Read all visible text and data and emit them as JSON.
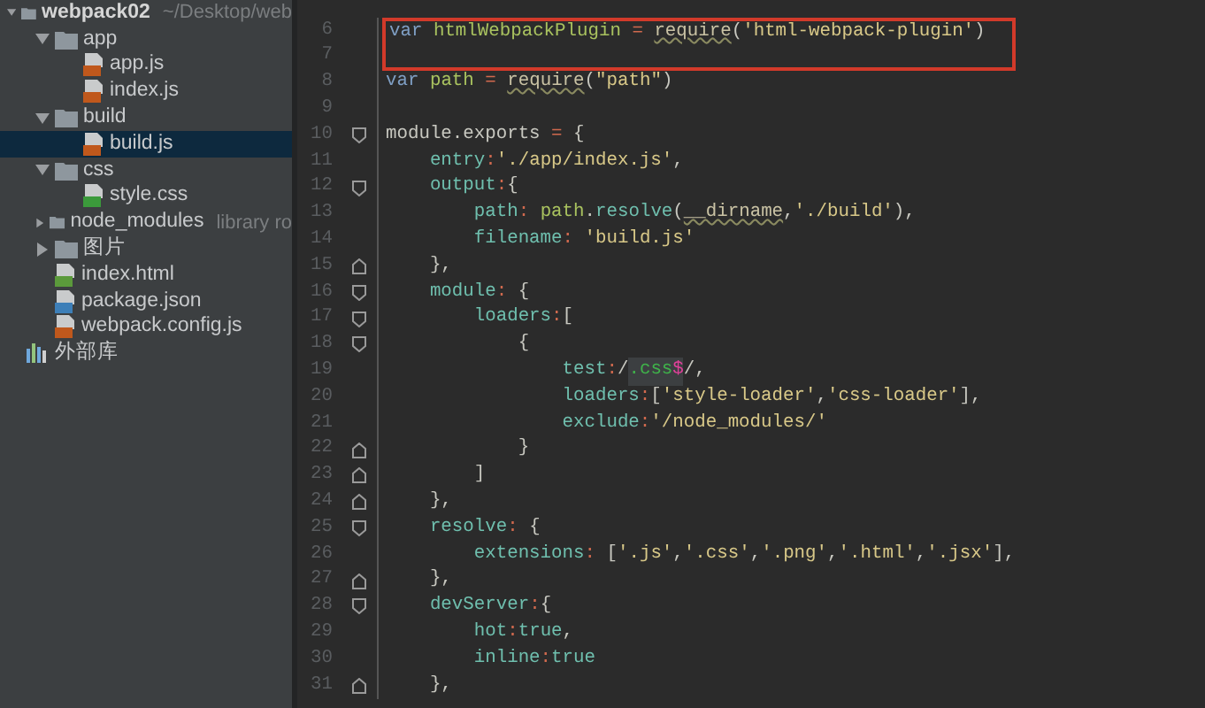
{
  "project_tree": [
    {
      "name": "webpack02",
      "note": "~/Desktop/web",
      "kind": "root",
      "expanded": true,
      "selected": false,
      "children": [
        {
          "name": "app",
          "kind": "folder",
          "expanded": true,
          "selected": false,
          "children": [
            {
              "name": "app.js",
              "kind": "js",
              "selected": false
            },
            {
              "name": "index.js",
              "kind": "js",
              "selected": false
            }
          ]
        },
        {
          "name": "build",
          "kind": "folder",
          "expanded": true,
          "selected": false,
          "children": [
            {
              "name": "build.js",
              "kind": "js",
              "selected": true
            }
          ]
        },
        {
          "name": "css",
          "kind": "folder",
          "expanded": true,
          "selected": false,
          "children": [
            {
              "name": "style.css",
              "kind": "css",
              "selected": false
            }
          ]
        },
        {
          "name": "node_modules",
          "note": "library ro",
          "kind": "folder",
          "expanded": false,
          "selected": false
        },
        {
          "name": "图片",
          "kind": "folder",
          "expanded": false,
          "selected": false
        },
        {
          "name": "index.html",
          "kind": "html",
          "selected": false
        },
        {
          "name": "package.json",
          "kind": "json",
          "selected": false
        },
        {
          "name": "webpack.config.js",
          "kind": "js",
          "selected": false
        }
      ]
    },
    {
      "name": "外部库",
      "kind": "library",
      "selected": false
    }
  ],
  "editor": {
    "lines": [
      {
        "number": "6",
        "kind": "plain",
        "highlighted": true,
        "tokens": [
          {
            "kind": "keyword",
            "text": "var "
          },
          {
            "kind": "variable",
            "text": "htmlWebpackPlugin "
          },
          {
            "kind": "operator",
            "text": "= "
          },
          {
            "kind": "call",
            "text": "require"
          },
          {
            "kind": "plain",
            "text": "("
          },
          {
            "kind": "string",
            "text": "'html-webpack-plugin'"
          },
          {
            "kind": "plain",
            "text": ")"
          }
        ]
      },
      {
        "number": "7",
        "kind": "plain",
        "highlighted": true
      },
      {
        "number": "8",
        "kind": "plain",
        "highlighted": false,
        "tokens": [
          {
            "kind": "keyword",
            "text": "var "
          },
          {
            "kind": "variable",
            "text": "path "
          },
          {
            "kind": "operator",
            "text": "= "
          },
          {
            "kind": "call",
            "text": "require"
          },
          {
            "kind": "plain",
            "text": "("
          },
          {
            "kind": "string",
            "text": "\"path\""
          },
          {
            "kind": "plain",
            "text": ")"
          }
        ]
      },
      {
        "number": "9",
        "kind": "plain",
        "highlighted": false
      },
      {
        "number": "10",
        "kind": "fold_open",
        "highlighted": false,
        "tokens": [
          {
            "kind": "plain",
            "text": "module.exports "
          },
          {
            "kind": "operator",
            "text": "= "
          },
          {
            "kind": "plain",
            "text": "{"
          }
        ]
      },
      {
        "number": "11",
        "kind": "plain",
        "highlighted": false,
        "tokens": [
          {
            "kind": "property",
            "text": "    entry"
          },
          {
            "kind": "operator",
            "text": ":"
          },
          {
            "kind": "string",
            "text": "'./app/index.js'"
          },
          {
            "kind": "plain",
            "text": ","
          }
        ]
      },
      {
        "number": "12",
        "kind": "fold_open",
        "highlighted": false,
        "tokens": [
          {
            "kind": "property",
            "text": "    output"
          },
          {
            "kind": "operator",
            "text": ":"
          },
          {
            "kind": "plain",
            "text": "{"
          }
        ]
      },
      {
        "number": "13",
        "kind": "plain",
        "highlighted": false,
        "tokens": [
          {
            "kind": "property",
            "text": "        path"
          },
          {
            "kind": "operator",
            "text": ": "
          },
          {
            "kind": "variable",
            "text": "path"
          },
          {
            "kind": "plain",
            "text": "."
          },
          {
            "kind": "property",
            "text": "resolve"
          },
          {
            "kind": "plain",
            "text": "("
          },
          {
            "kind": "call",
            "text": "__dirname"
          },
          {
            "kind": "plain",
            "text": ","
          },
          {
            "kind": "string",
            "text": "'./build'"
          },
          {
            "kind": "plain",
            "text": "),"
          }
        ]
      },
      {
        "number": "14",
        "kind": "plain",
        "highlighted": false,
        "tokens": [
          {
            "kind": "property",
            "text": "        filename"
          },
          {
            "kind": "operator",
            "text": ": "
          },
          {
            "kind": "string",
            "text": "'build.js'"
          }
        ]
      },
      {
        "number": "15",
        "kind": "fold_close",
        "highlighted": false,
        "tokens": [
          {
            "kind": "plain",
            "text": "    },"
          }
        ]
      },
      {
        "number": "16",
        "kind": "fold_open",
        "highlighted": false,
        "tokens": [
          {
            "kind": "property",
            "text": "    module"
          },
          {
            "kind": "operator",
            "text": ": "
          },
          {
            "kind": "plain",
            "text": "{"
          }
        ]
      },
      {
        "number": "17",
        "kind": "fold_open",
        "highlighted": false,
        "tokens": [
          {
            "kind": "property",
            "text": "        loaders"
          },
          {
            "kind": "operator",
            "text": ":"
          },
          {
            "kind": "plain",
            "text": "["
          }
        ]
      },
      {
        "number": "18",
        "kind": "fold_open",
        "highlighted": false,
        "tokens": [
          {
            "kind": "plain",
            "text": "            {"
          }
        ]
      },
      {
        "number": "19",
        "kind": "plain",
        "highlighted": false,
        "tokens": [
          {
            "kind": "property",
            "text": "                test"
          },
          {
            "kind": "operator",
            "text": ":"
          },
          {
            "kind": "plain",
            "text": "/"
          },
          {
            "kind": "regex",
            "text": ".css"
          },
          {
            "kind": "regex_anchor",
            "text": "$"
          },
          {
            "kind": "plain",
            "text": "/,"
          }
        ]
      },
      {
        "number": "20",
        "kind": "plain",
        "highlighted": false,
        "tokens": [
          {
            "kind": "property",
            "text": "                loaders"
          },
          {
            "kind": "operator",
            "text": ":"
          },
          {
            "kind": "plain",
            "text": "["
          },
          {
            "kind": "string",
            "text": "'style-loader'"
          },
          {
            "kind": "plain",
            "text": ","
          },
          {
            "kind": "string",
            "text": "'css-loader'"
          },
          {
            "kind": "plain",
            "text": "],"
          }
        ]
      },
      {
        "number": "21",
        "kind": "plain",
        "highlighted": false,
        "tokens": [
          {
            "kind": "property",
            "text": "                exclude"
          },
          {
            "kind": "operator",
            "text": ":"
          },
          {
            "kind": "string",
            "text": "'/node_modules/'"
          }
        ]
      },
      {
        "number": "22",
        "kind": "fold_close",
        "highlighted": false,
        "tokens": [
          {
            "kind": "plain",
            "text": "            }"
          }
        ]
      },
      {
        "number": "23",
        "kind": "fold_close",
        "highlighted": false,
        "tokens": [
          {
            "kind": "plain",
            "text": "        ]"
          }
        ]
      },
      {
        "number": "24",
        "kind": "fold_close",
        "highlighted": false,
        "tokens": [
          {
            "kind": "plain",
            "text": "    },"
          }
        ]
      },
      {
        "number": "25",
        "kind": "fold_open",
        "highlighted": false,
        "tokens": [
          {
            "kind": "property",
            "text": "    resolve"
          },
          {
            "kind": "operator",
            "text": ": "
          },
          {
            "kind": "plain",
            "text": "{"
          }
        ]
      },
      {
        "number": "26",
        "kind": "plain",
        "highlighted": false,
        "tokens": [
          {
            "kind": "property",
            "text": "        extensions"
          },
          {
            "kind": "operator",
            "text": ": "
          },
          {
            "kind": "plain",
            "text": "["
          },
          {
            "kind": "string",
            "text": "'.js'"
          },
          {
            "kind": "plain",
            "text": ","
          },
          {
            "kind": "string",
            "text": "'.css'"
          },
          {
            "kind": "plain",
            "text": ","
          },
          {
            "kind": "string",
            "text": "'.png'"
          },
          {
            "kind": "plain",
            "text": ","
          },
          {
            "kind": "string",
            "text": "'.html'"
          },
          {
            "kind": "plain",
            "text": ","
          },
          {
            "kind": "string",
            "text": "'.jsx'"
          },
          {
            "kind": "plain",
            "text": "],"
          }
        ]
      },
      {
        "number": "27",
        "kind": "fold_close",
        "highlighted": false,
        "tokens": [
          {
            "kind": "plain",
            "text": "    },"
          }
        ]
      },
      {
        "number": "28",
        "kind": "fold_open",
        "highlighted": false,
        "tokens": [
          {
            "kind": "property",
            "text": "    devServer"
          },
          {
            "kind": "operator",
            "text": ":"
          },
          {
            "kind": "plain",
            "text": "{"
          }
        ]
      },
      {
        "number": "29",
        "kind": "plain",
        "highlighted": false,
        "tokens": [
          {
            "kind": "property",
            "text": "        hot"
          },
          {
            "kind": "operator",
            "text": ":"
          },
          {
            "kind": "property",
            "text": "true"
          },
          {
            "kind": "plain",
            "text": ","
          }
        ]
      },
      {
        "number": "30",
        "kind": "plain",
        "highlighted": false,
        "tokens": [
          {
            "kind": "property",
            "text": "        inline"
          },
          {
            "kind": "operator",
            "text": ":"
          },
          {
            "kind": "property",
            "text": "true"
          }
        ]
      },
      {
        "number": "31",
        "kind": "fold_close",
        "highlighted": false,
        "tokens": [
          {
            "kind": "plain",
            "text": "    },"
          }
        ]
      }
    ]
  }
}
